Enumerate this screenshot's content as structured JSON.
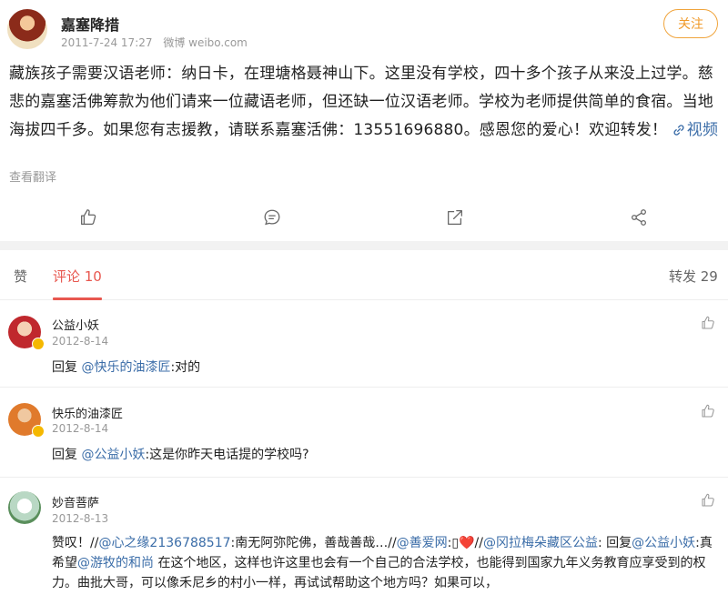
{
  "post": {
    "author": "嘉塞降措",
    "date": "2011-7-24 17:27",
    "source": "微博 weibo.com",
    "follow_label": "关注",
    "text": "藏族孩子需要汉语老师：纳日卡，在理塘格聂神山下。这里没有学校，四十多个孩子从来没上过学。慈悲的嘉塞活佛筹款为他们请来一位藏语老师，但还缺一位汉语老师。学校为老师提供简单的食宿。当地海拔四千多。如果您有志援教，请联系嘉塞活佛：13551696880。感恩您的爱心！欢迎转发！",
    "video_label": "视频",
    "translate_label": "查看翻译"
  },
  "actions": [
    {
      "name": "like-icon"
    },
    {
      "name": "comment-icon"
    },
    {
      "name": "repost-icon"
    },
    {
      "name": "share-icon"
    }
  ],
  "tabs": {
    "like": "赞",
    "comments": "评论 10",
    "reposts": "转发 29"
  },
  "comments": [
    {
      "name": "公益小妖",
      "date": "2012-8-14",
      "parts": [
        {
          "t": "回复 "
        },
        {
          "t": "@快乐的油漆匠",
          "link": true
        },
        {
          "t": ":对的"
        }
      ]
    },
    {
      "name": "快乐的油漆匠",
      "date": "2012-8-14",
      "parts": [
        {
          "t": "回复 "
        },
        {
          "t": "@公益小妖",
          "link": true
        },
        {
          "t": ":这是你昨天电话提的学校吗?"
        }
      ]
    },
    {
      "name": "妙音菩萨",
      "date": "2012-8-13",
      "parts": [
        {
          "t": "赞叹！//"
        },
        {
          "t": "@心之缘2136788517",
          "link": true
        },
        {
          "t": ":南无阿弥陀佛，善哉善哉…//"
        },
        {
          "t": "@善爱网",
          "link": true
        },
        {
          "t": ":▯❤️//"
        },
        {
          "t": "@冈拉梅朵藏区公益",
          "link": true
        },
        {
          "t": ": 回复"
        },
        {
          "t": "@公益小妖",
          "link": true
        },
        {
          "t": ":真希望"
        },
        {
          "t": "@游牧的和尚",
          "link": true
        },
        {
          "t": " 在这个地区，这样也许这里也会有一个自己的合法学校，也能得到国家九年义务教育应享受到的权力。曲批大哥，可以像禾尼乡的村小一样，再试试帮助这个地方吗？如果可以，"
        }
      ]
    }
  ],
  "colors": {
    "accent_red": "#e8574f",
    "link_blue": "#3b6da8",
    "follow_orange": "#f09a2a",
    "badge_yellow": "#f5b800"
  }
}
